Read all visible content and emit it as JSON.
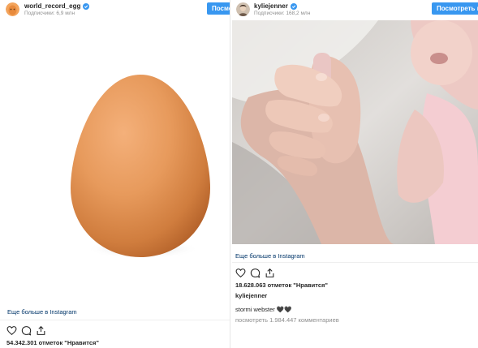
{
  "left_post": {
    "username": "world_record_egg",
    "followers": "Подписчики: 6,9 млн",
    "follow_button": "Посмотреть профиль",
    "photo_alt": "egg",
    "more_link": "Еще больше в Instagram",
    "likes": "54.342.301 отметок \"Нравится\""
  },
  "right_post": {
    "username": "kyliejenner",
    "followers": "Подписчики: 168,2 млн",
    "follow_button": "Посмотреть профиль",
    "more_link": "Еще больше в Instagram",
    "likes": "18.628.063 отметок \"Нравится\"",
    "caption_user": "kyliejenner",
    "comment_user": "stormi webster",
    "comment_text": "🖤🖤",
    "view_all_comments": "посмотреть 1.984.447 комментариев"
  },
  "colors": {
    "accent": "#3897f0",
    "link": "#003569",
    "verified": "#3897f0",
    "egg": "#d9894a"
  },
  "icons": [
    "verified-icon",
    "heart-icon",
    "comment-icon",
    "share-icon"
  ]
}
